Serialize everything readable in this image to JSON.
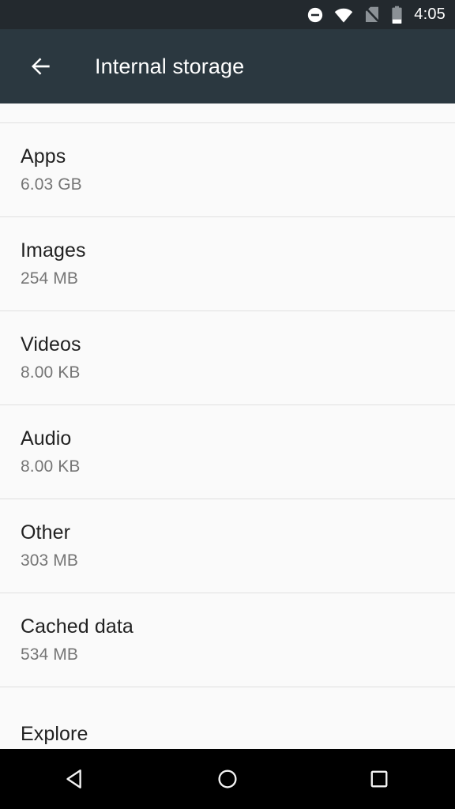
{
  "status_bar": {
    "time": "4:05",
    "icons": [
      {
        "name": "do-not-disturb-icon",
        "label": "Do not disturb"
      },
      {
        "name": "wifi-icon",
        "label": "Wi-Fi full signal"
      },
      {
        "name": "no-sim-icon",
        "label": "No SIM card"
      },
      {
        "name": "battery-icon",
        "label": "Battery low"
      }
    ],
    "background": "#23292e",
    "foreground": "#ffffff"
  },
  "app_bar": {
    "title": "Internal storage",
    "back_label": "Navigate up",
    "background": "#2b3840",
    "foreground": "#ffffff"
  },
  "storage_list": {
    "items": [
      {
        "title": "Apps",
        "size": "6.03 GB"
      },
      {
        "title": "Images",
        "size": "254 MB"
      },
      {
        "title": "Videos",
        "size": "8.00 KB"
      },
      {
        "title": "Audio",
        "size": "8.00 KB"
      },
      {
        "title": "Other",
        "size": "303 MB"
      },
      {
        "title": "Cached data",
        "size": "534 MB"
      },
      {
        "title": "Explore",
        "size": ""
      }
    ],
    "background": "#fafafa",
    "title_color": "#212121",
    "subtitle_color": "#757575",
    "divider_color": "#e0e0e0"
  },
  "nav_bar": {
    "background": "#000000",
    "buttons": [
      {
        "name": "nav-back-button",
        "label": "Back"
      },
      {
        "name": "nav-home-button",
        "label": "Home"
      },
      {
        "name": "nav-recents-button",
        "label": "Recent apps"
      }
    ]
  }
}
